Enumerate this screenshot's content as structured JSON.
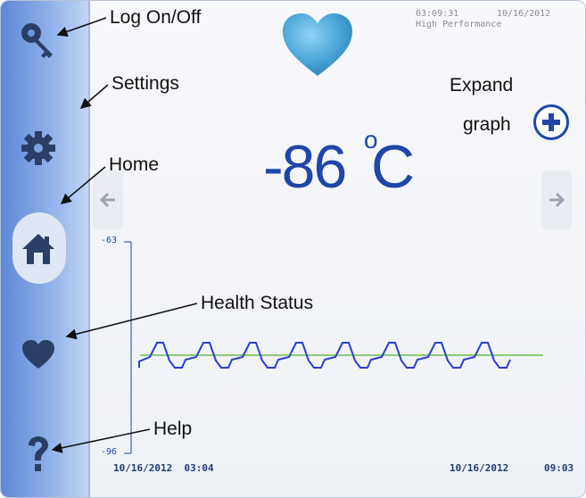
{
  "status": {
    "time": "03:09:31",
    "date": "10/16/2012",
    "mode": "High Performance"
  },
  "temperature": {
    "value": "-86",
    "degree": "o",
    "unit": "C"
  },
  "graph": {
    "y_max_label": "-63",
    "y_min_label": "-96",
    "x_start_label": "10/16/2012  03:04",
    "x_end_date": "10/16/2012",
    "x_end_time": "09:03"
  },
  "annotations": {
    "log_on_off": "Log On/Off",
    "settings": "Settings",
    "home": "Home",
    "health_status": "Health Status",
    "help": "Help",
    "expand_line1": "Expand",
    "expand_line2": "graph"
  },
  "icons": {
    "key": "key-icon",
    "settings": "gear-icon",
    "home": "home-icon",
    "health": "heart-icon",
    "help": "question-icon",
    "expand": "plus-icon",
    "prev": "arrow-left-icon",
    "next": "arrow-right-icon"
  },
  "colors": {
    "accent": "#1f46a8",
    "sidebar": "#6f96dd",
    "heart": "#4aa6d8",
    "trace": "#2a3fd0",
    "setpoint": "#6bbf4a"
  }
}
